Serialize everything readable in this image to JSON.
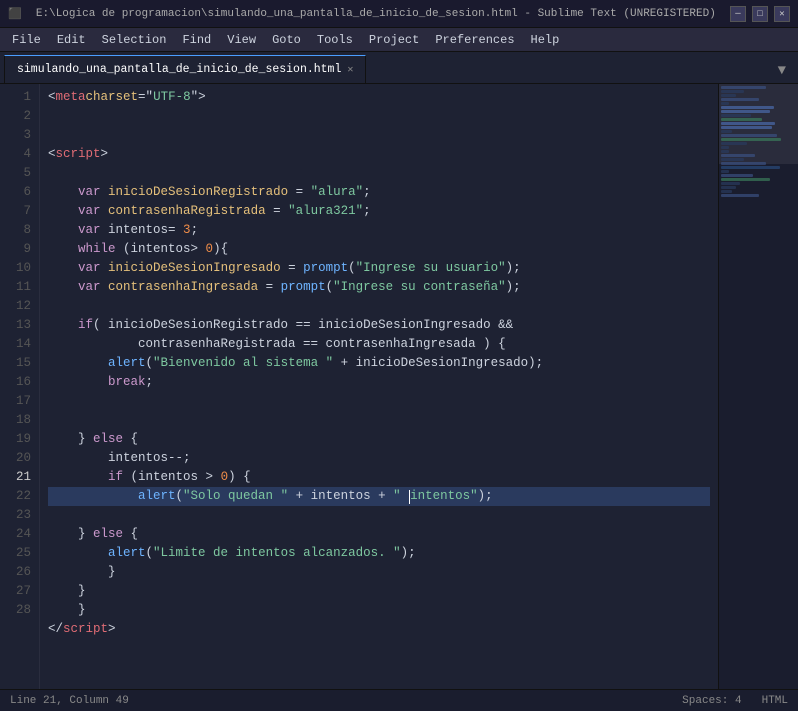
{
  "titleBar": {
    "text": "E:\\Logica de programacion\\simulando_una_pantalla_de_inicio_de_sesion.html - Sublime Text (UNREGISTERED)",
    "minimize": "─",
    "maximize": "□",
    "close": "✕"
  },
  "menuBar": {
    "items": [
      "File",
      "Edit",
      "Selection",
      "Find",
      "View",
      "Goto",
      "Tools",
      "Project",
      "Preferences",
      "Help"
    ]
  },
  "tabBar": {
    "tabs": [
      {
        "label": "simulando_una_pantalla_de_inicio_de_sesion.html",
        "active": true
      }
    ]
  },
  "statusBar": {
    "position": "Line 21, Column 49",
    "spaces": "Spaces: 4",
    "language": "HTML"
  },
  "codeLines": [
    {
      "num": 1,
      "content": "meta",
      "highlighted": false
    },
    {
      "num": 2,
      "content": "",
      "highlighted": false
    },
    {
      "num": 3,
      "content": "",
      "highlighted": false
    },
    {
      "num": 4,
      "content": "script",
      "highlighted": false
    },
    {
      "num": 5,
      "content": "",
      "highlighted": false
    },
    {
      "num": 6,
      "content": "var inicioDeSesionRegistrado",
      "highlighted": false
    },
    {
      "num": 7,
      "content": "var contrasenhaRegistrada",
      "highlighted": false
    },
    {
      "num": 8,
      "content": "var intentos",
      "highlighted": false
    },
    {
      "num": 9,
      "content": "while",
      "highlighted": false
    },
    {
      "num": 10,
      "content": "var inicioDeSesionIngresado",
      "highlighted": false
    },
    {
      "num": 11,
      "content": "var contrasenhaIngresada",
      "highlighted": false
    },
    {
      "num": 12,
      "content": "",
      "highlighted": false
    },
    {
      "num": 13,
      "content": "if",
      "highlighted": false
    },
    {
      "num": 14,
      "content": "alert bienvenido",
      "highlighted": false
    },
    {
      "num": 15,
      "content": "break",
      "highlighted": false
    },
    {
      "num": 16,
      "content": "",
      "highlighted": false
    },
    {
      "num": 17,
      "content": "",
      "highlighted": false
    },
    {
      "num": 18,
      "content": "else",
      "highlighted": false
    },
    {
      "num": 19,
      "content": "intentos--",
      "highlighted": false
    },
    {
      "num": 20,
      "content": "if intentos > 0",
      "highlighted": false
    },
    {
      "num": 21,
      "content": "alert solo quedan",
      "highlighted": true
    },
    {
      "num": 22,
      "content": "",
      "highlighted": false
    },
    {
      "num": 23,
      "content": "else",
      "highlighted": false
    },
    {
      "num": 24,
      "content": "alert limite",
      "highlighted": false
    },
    {
      "num": 25,
      "content": "}",
      "highlighted": false
    },
    {
      "num": 26,
      "content": "}",
      "highlighted": false
    },
    {
      "num": 27,
      "content": "}",
      "highlighted": false
    },
    {
      "num": 28,
      "content": "/script",
      "highlighted": false
    }
  ]
}
